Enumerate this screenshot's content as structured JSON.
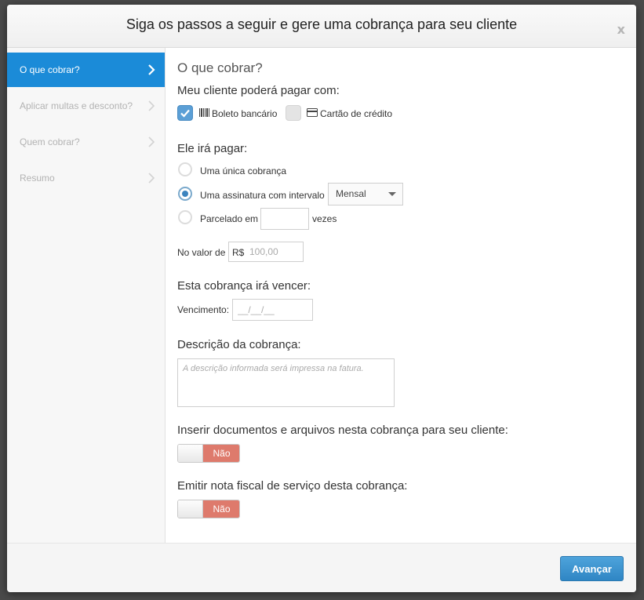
{
  "modal": {
    "title": "Siga os passos a seguir e gere uma cobrança para seu cliente",
    "close": "x"
  },
  "sidebar": {
    "items": [
      {
        "label": "O que cobrar?",
        "active": true
      },
      {
        "label": "Aplicar multas e desconto?",
        "active": false
      },
      {
        "label": "Quem cobrar?",
        "active": false
      },
      {
        "label": "Resumo",
        "active": false
      }
    ]
  },
  "main": {
    "section_title": "O que cobrar?",
    "payment_methods": {
      "label": "Meu cliente poderá pagar com:",
      "boleto": {
        "label": "Boleto bancário",
        "checked": true,
        "icon": "barcode-icon"
      },
      "cartao": {
        "label": "Cartão de crédito",
        "checked": false,
        "icon": "credit-card-icon"
      }
    },
    "pay_type": {
      "label": "Ele irá pagar:",
      "single": "Uma única cobrança",
      "subscription": "Uma assinatura com intervalo",
      "subscription_interval": "Mensal",
      "installments_prefix": "Parcelado em",
      "installments_suffix": "vezes",
      "installments_value": "",
      "selected": "subscription"
    },
    "amount": {
      "label": "No valor de",
      "currency": "R$",
      "placeholder": "100,00"
    },
    "due": {
      "label": "Esta cobrança irá vencer:",
      "field_label": "Vencimento:",
      "placeholder": "__/__/__"
    },
    "description": {
      "label": "Descrição da cobrança:",
      "placeholder": "A descrição informada será impressa na fatura."
    },
    "attachments": {
      "label": "Inserir documentos e arquivos nesta cobrança para seu cliente:",
      "toggle": "Não"
    },
    "invoice": {
      "label": "Emitir nota fiscal de serviço desta cobrança:",
      "toggle": "Não"
    }
  },
  "footer": {
    "next_label": "Avançar"
  },
  "colors": {
    "accent": "#1b8bd8",
    "toggle_off": "#de7a6c",
    "primary_button": "#3a92ce"
  }
}
